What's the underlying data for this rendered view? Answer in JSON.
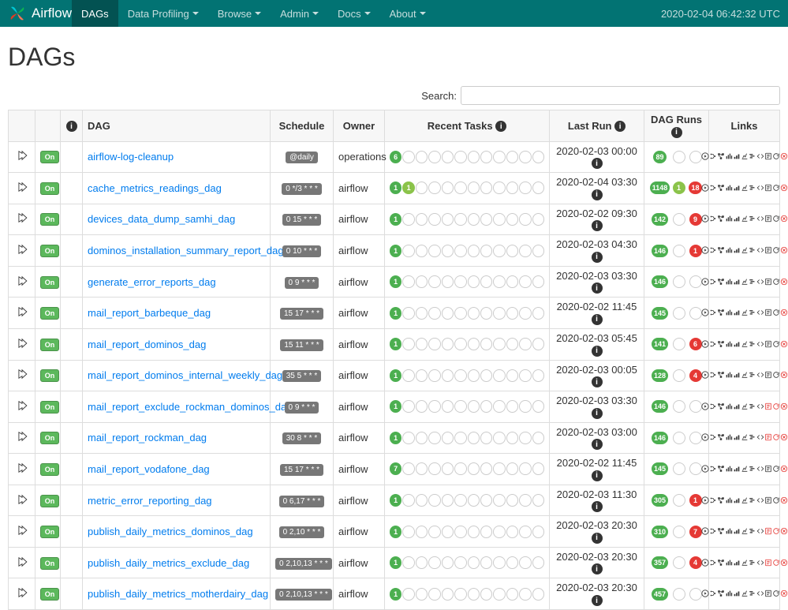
{
  "nav": {
    "brand": "Airflow",
    "items": [
      "DAGs",
      "Data Profiling",
      "Browse",
      "Admin",
      "Docs",
      "About"
    ],
    "clock": "2020-02-04 06:42:32 UTC"
  },
  "page_title": "DAGs",
  "search_label": "Search:",
  "headers": {
    "dag": "DAG",
    "schedule": "Schedule",
    "owner": "Owner",
    "recent_tasks": "Recent Tasks",
    "last_run": "Last Run",
    "dag_runs": "DAG Runs",
    "links": "Links"
  },
  "rows": [
    {
      "toggle": "On",
      "dag": "airflow-log-cleanup",
      "schedule": "@daily",
      "owner": "operations",
      "tasks_first": "6",
      "tasks_first_style": "green",
      "last_run": "2020-02-03 00:00",
      "runs": {
        "a": "89"
      },
      "bad": true
    },
    {
      "toggle": "On",
      "dag": "cache_metrics_readings_dag",
      "schedule": "0 */3 * * *",
      "owner": "airflow",
      "tasks_first": "1",
      "tasks_first_style": "green",
      "tasks_second": "1",
      "last_run": "2020-02-04 03:30",
      "runs": {
        "a": "1148",
        "b": "1",
        "c": "18"
      },
      "bad": true
    },
    {
      "toggle": "On",
      "dag": "devices_data_dump_samhi_dag",
      "schedule": "0 15 * * *",
      "owner": "airflow",
      "tasks_first": "1",
      "tasks_first_style": "green",
      "last_run": "2020-02-02 09:30",
      "runs": {
        "a": "142",
        "c": "9"
      },
      "bad": true
    },
    {
      "toggle": "On",
      "dag": "dominos_installation_summary_report_dag",
      "schedule": "0 10 * * *",
      "owner": "airflow",
      "tasks_first": "1",
      "tasks_first_style": "green",
      "last_run": "2020-02-03 04:30",
      "runs": {
        "a": "146",
        "c": "1"
      },
      "bad": true
    },
    {
      "toggle": "On",
      "dag": "generate_error_reports_dag",
      "schedule": "0 9 * * *",
      "owner": "airflow",
      "tasks_first": "1",
      "tasks_first_style": "green",
      "last_run": "2020-02-03 03:30",
      "runs": {
        "a": "146"
      },
      "bad": true
    },
    {
      "toggle": "On",
      "dag": "mail_report_barbeque_dag",
      "schedule": "15 17 * * *",
      "owner": "airflow",
      "tasks_first": "1",
      "tasks_first_style": "green",
      "last_run": "2020-02-02 11:45",
      "runs": {
        "a": "145"
      },
      "bad": true
    },
    {
      "toggle": "On",
      "dag": "mail_report_dominos_dag",
      "schedule": "15 11 * * *",
      "owner": "airflow",
      "tasks_first": "1",
      "tasks_first_style": "green",
      "last_run": "2020-02-03 05:45",
      "runs": {
        "a": "141",
        "c": "6"
      },
      "bad": true
    },
    {
      "toggle": "On",
      "dag": "mail_report_dominos_internal_weekly_dag",
      "schedule": "35 5 * * *",
      "owner": "airflow",
      "tasks_first": "1",
      "tasks_first_style": "green",
      "last_run": "2020-02-03 00:05",
      "runs": {
        "a": "128",
        "c": "4"
      },
      "bad": true
    },
    {
      "toggle": "On",
      "dag": "mail_report_exclude_rockman_dominos_dag",
      "schedule": "0 9 * * *",
      "owner": "airflow",
      "tasks_first": "1",
      "tasks_first_style": "green",
      "last_run": "2020-02-03 03:30",
      "runs": {
        "a": "146"
      },
      "bad": true,
      "extra_bad": true
    },
    {
      "toggle": "On",
      "dag": "mail_report_rockman_dag",
      "schedule": "30 8 * * *",
      "owner": "airflow",
      "tasks_first": "1",
      "tasks_first_style": "green",
      "last_run": "2020-02-03 03:00",
      "runs": {
        "a": "146"
      },
      "bad": true,
      "extra_bad": true
    },
    {
      "toggle": "On",
      "dag": "mail_report_vodafone_dag",
      "schedule": "15 17 * * *",
      "owner": "airflow",
      "tasks_first": "7",
      "tasks_first_style": "green",
      "last_run": "2020-02-02 11:45",
      "runs": {
        "a": "145"
      },
      "bad": true
    },
    {
      "toggle": "On",
      "dag": "metric_error_reporting_dag",
      "schedule": "0 6,17 * * *",
      "owner": "airflow",
      "tasks_first": "1",
      "tasks_first_style": "green",
      "last_run": "2020-02-03 11:30",
      "runs": {
        "a": "305",
        "c": "1"
      },
      "bad": true
    },
    {
      "toggle": "On",
      "dag": "publish_daily_metrics_dominos_dag",
      "schedule": "0 2,10 * * *",
      "owner": "airflow",
      "tasks_first": "1",
      "tasks_first_style": "green",
      "last_run": "2020-02-03 20:30",
      "runs": {
        "a": "310",
        "c": "7"
      },
      "bad": true,
      "extra_bad": true
    },
    {
      "toggle": "On",
      "dag": "publish_daily_metrics_exclude_dag",
      "schedule": "0 2,10,13 * * *",
      "owner": "airflow",
      "tasks_first": "1",
      "tasks_first_style": "green",
      "last_run": "2020-02-03 20:30",
      "runs": {
        "a": "357",
        "c": "4"
      },
      "bad": true,
      "extra_bad": true
    },
    {
      "toggle": "On",
      "dag": "publish_daily_metrics_motherdairy_dag",
      "schedule": "0 2,10,13 * * *",
      "owner": "airflow",
      "tasks_first": "1",
      "tasks_first_style": "green",
      "last_run": "2020-02-03 20:30",
      "runs": {
        "a": "457"
      },
      "bad": true
    }
  ]
}
